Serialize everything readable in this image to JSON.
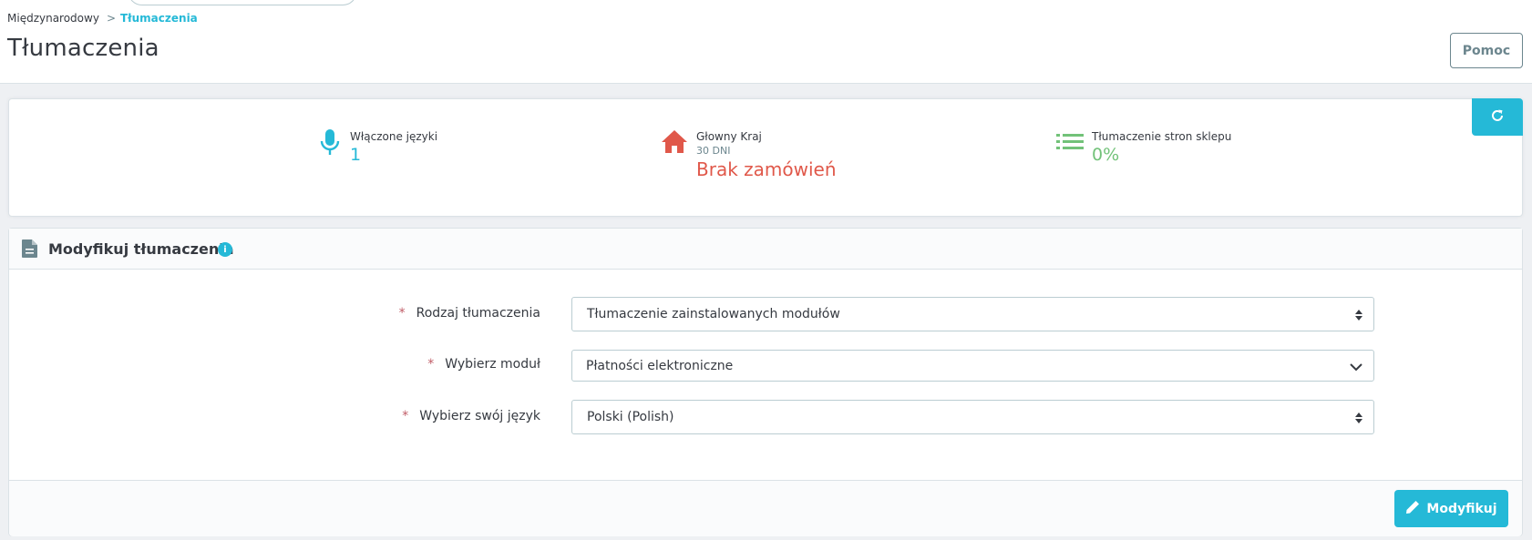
{
  "breadcrumb": {
    "parent": "Międzynarodowy",
    "separator": ">",
    "current": "Tłumaczenia"
  },
  "page": {
    "title": "Tłumaczenia",
    "help_label": "Pomoc"
  },
  "kpis": [
    {
      "icon": "microphone-icon",
      "label": "Włączone języki",
      "sub": "",
      "value": "1",
      "color": "#25b9d7"
    },
    {
      "icon": "home-icon",
      "label": "Głowny Kraj",
      "sub": "30 DNI",
      "value": "Brak zamówień",
      "color": "#e0584a"
    },
    {
      "icon": "list-icon",
      "label": "Tłumaczenie stron sklepu",
      "sub": "",
      "value": "0%",
      "color": "#72c279"
    }
  ],
  "panel": {
    "title": "Modyfikuj tłumaczenia",
    "info_glyph": "i",
    "fields": [
      {
        "required_mark": "*",
        "label": "Rodzaj tłumaczenia",
        "value": "Tłumaczenie zainstalowanych modułów"
      },
      {
        "required_mark": "*",
        "label": "Wybierz moduł",
        "value": "Płatności elektroniczne"
      },
      {
        "required_mark": "*",
        "label": "Wybierz swój język",
        "value": "Polski (Polish)"
      }
    ],
    "submit_label": "Modyfikuj"
  },
  "colors": {
    "primary": "#25b9d7",
    "danger": "#e0584a",
    "success": "#72c279",
    "text": "#363a41",
    "muted": "#6c868e"
  }
}
